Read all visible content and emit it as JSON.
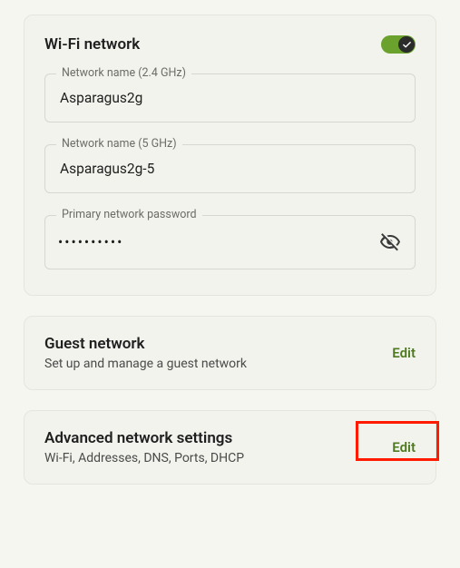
{
  "wifi": {
    "title": "Wi-Fi network",
    "enabled": true,
    "fields": {
      "ssid24": {
        "label": "Network name (2.4 GHz)",
        "value": "Asparagus2g"
      },
      "ssid5": {
        "label": "Network name (5 GHz)",
        "value": "Asparagus2g-5"
      },
      "password": {
        "label": "Primary network password",
        "masked": "••••••••••"
      }
    }
  },
  "guest": {
    "title": "Guest network",
    "subtitle": "Set up and manage a guest network",
    "action": "Edit"
  },
  "advanced": {
    "title": "Advanced network settings",
    "subtitle": "Wi-Fi, Addresses, DNS, Ports, DHCP",
    "action": "Edit"
  },
  "colors": {
    "accent": "#4e7a1f",
    "toggle_on": "#6aa22d",
    "highlight": "#ff1a00"
  }
}
